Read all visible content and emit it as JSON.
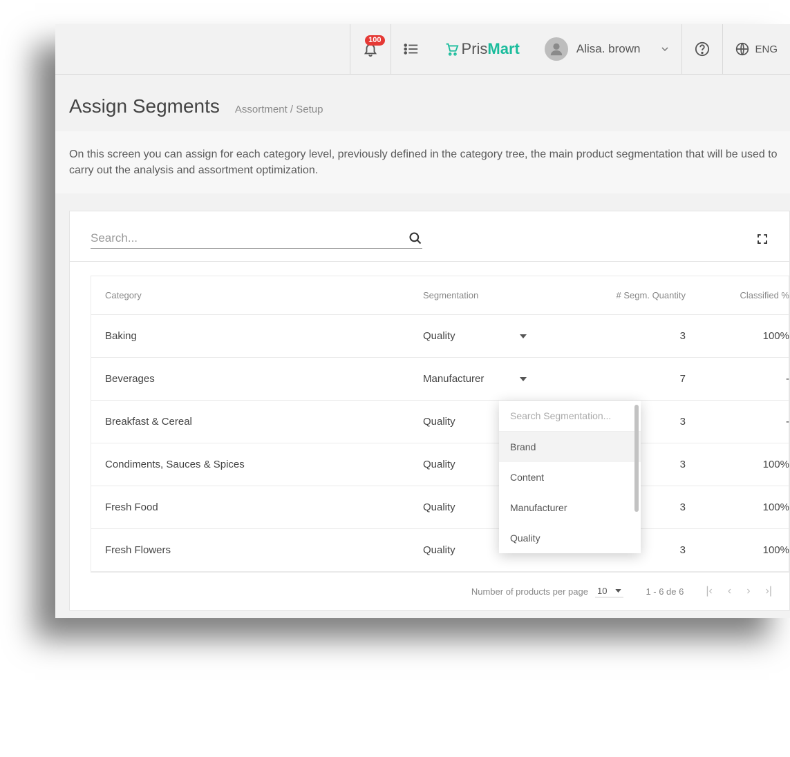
{
  "topbar": {
    "notification_count": "100",
    "app_name_pris": "Pris",
    "app_name_mart": "Mart",
    "username": "Alisa. brown",
    "language": "ENG"
  },
  "header": {
    "title": "Assign Segments",
    "breadcrumb": "Assortment / Setup"
  },
  "description": "On this screen you can assign for each category level, previously defined in the category tree, the main product segmentation that will be used to carry out the analysis and assortment optimization.",
  "search": {
    "placeholder": "Search..."
  },
  "table": {
    "columns": {
      "category": "Category",
      "segmentation": "Segmentation",
      "qty": "# Segm. Quantity",
      "classified": "Classified %"
    },
    "rows": [
      {
        "category": "Baking",
        "segmentation": "Quality",
        "qty": "3",
        "classified": "100%"
      },
      {
        "category": "Beverages",
        "segmentation": "Manufacturer",
        "qty": "7",
        "classified": "-"
      },
      {
        "category": "Breakfast & Cereal",
        "segmentation": "Quality",
        "qty": "3",
        "classified": "-"
      },
      {
        "category": "Condiments, Sauces & Spices",
        "segmentation": "Quality",
        "qty": "3",
        "classified": "100%"
      },
      {
        "category": "Fresh Food",
        "segmentation": "Quality",
        "qty": "3",
        "classified": "100%"
      },
      {
        "category": "Fresh Flowers",
        "segmentation": "Quality",
        "qty": "3",
        "classified": "100%"
      }
    ]
  },
  "dropdown": {
    "search_placeholder": "Search Segmentation...",
    "options": [
      "Brand",
      "Content",
      "Manufacturer",
      "Quality"
    ]
  },
  "pagination": {
    "label": "Number of products per page",
    "page_size": "10",
    "range": "1 - 6 de 6"
  }
}
